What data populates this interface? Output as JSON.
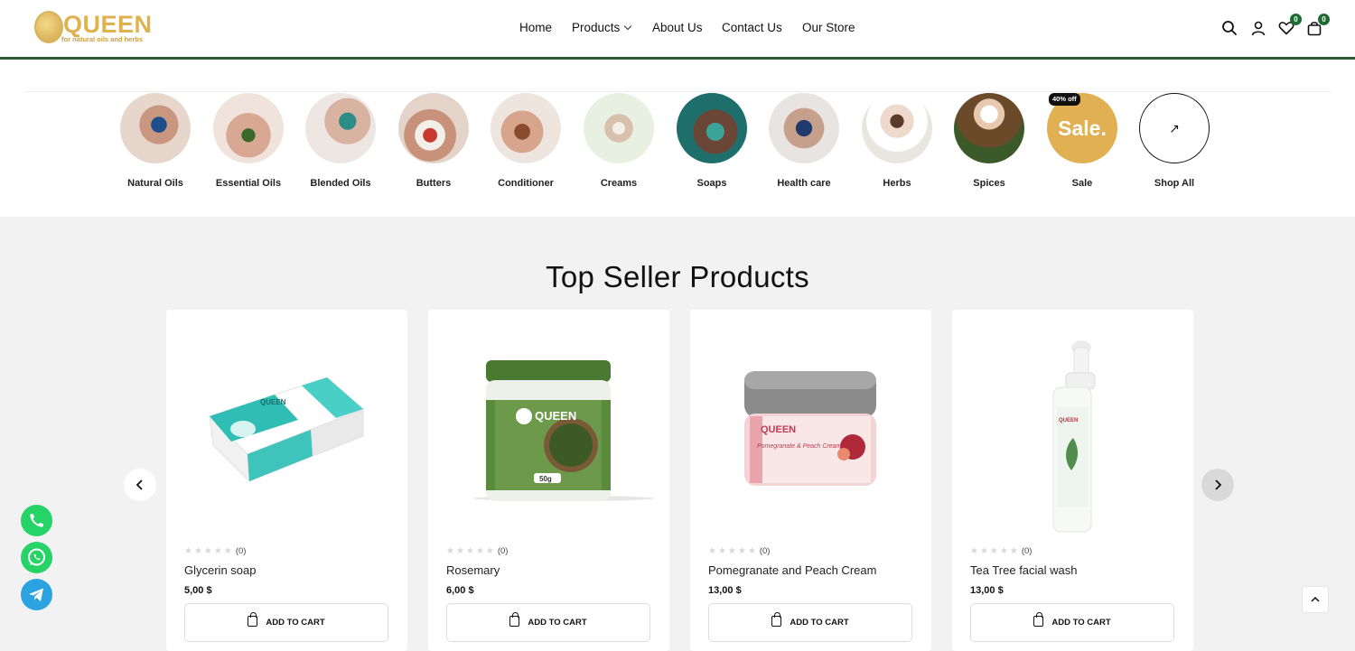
{
  "header": {
    "logo_text": "QUEEN",
    "logo_tagline": "for natural oils and herbs",
    "nav": [
      {
        "label": "Home"
      },
      {
        "label": "Products"
      },
      {
        "label": "About Us"
      },
      {
        "label": "Contact Us"
      },
      {
        "label": "Our Store"
      }
    ],
    "wishlist_count": "0",
    "cart_count": "0"
  },
  "categories": [
    {
      "label": "Natural Oils"
    },
    {
      "label": "Essential Oils"
    },
    {
      "label": "Blended Oils"
    },
    {
      "label": "Butters"
    },
    {
      "label": "Conditioner"
    },
    {
      "label": "Creams"
    },
    {
      "label": "Soaps"
    },
    {
      "label": "Health care"
    },
    {
      "label": "Herbs"
    },
    {
      "label": "Spices"
    },
    {
      "label": "Sale",
      "circle_text": "Sale.",
      "tag": "40% off"
    },
    {
      "label": "Shop All",
      "icon": "↗"
    }
  ],
  "section": {
    "title": "Top Seller Products"
  },
  "products": [
    {
      "name": "Glycerin soap",
      "price": "5,00 $",
      "rating_count": "(0)",
      "button": "ADD TO CART"
    },
    {
      "name": "Rosemary",
      "price": "6,00 $",
      "rating_count": "(0)",
      "button": "ADD TO CART"
    },
    {
      "name": "Pomegranate and Peach Cream",
      "price": "13,00 $",
      "rating_count": "(0)",
      "button": "ADD TO CART"
    },
    {
      "name": "Tea Tree facial wash",
      "price": "13,00 $",
      "rating_count": "(0)",
      "button": "ADD TO CART"
    }
  ],
  "colors": {
    "brand_gold": "#e0b24e",
    "brand_green": "#2e5a2f",
    "badge_green": "#1f6b34",
    "phone": "#25d366",
    "whatsapp": "#25d366",
    "telegram": "#2aa3e0"
  }
}
